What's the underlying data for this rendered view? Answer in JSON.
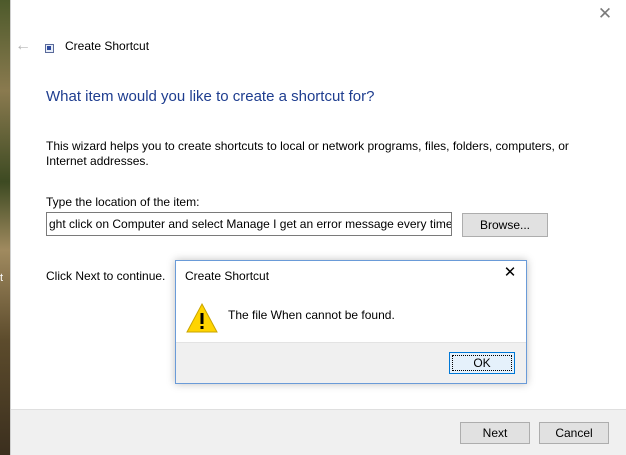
{
  "desktop": {
    "edge_glyph": "t"
  },
  "wizard": {
    "title": "Create Shortcut",
    "heading": "What item would you like to create a shortcut for?",
    "description": "This wizard helps you to create shortcuts to local or network programs, files, folders, computers, or Internet addresses.",
    "location_label": "Type the location of the item:",
    "location_value": "ght click on Computer and select Manage I get an error message every time.",
    "browse_label": "Browse...",
    "continue_text": "Click Next to continue.",
    "next_label": "Next",
    "cancel_label": "Cancel"
  },
  "modal": {
    "title": "Create Shortcut",
    "message": "The file When cannot be found.",
    "ok_label": "OK",
    "icon": "warning-icon"
  },
  "icons": {
    "close": "close-icon",
    "back": "back-arrow-icon",
    "shortcut": "shortcut-icon"
  },
  "colors": {
    "heading": "#1e3d8f",
    "warning_fill": "#ffd400",
    "focus_border": "#0078d7"
  }
}
